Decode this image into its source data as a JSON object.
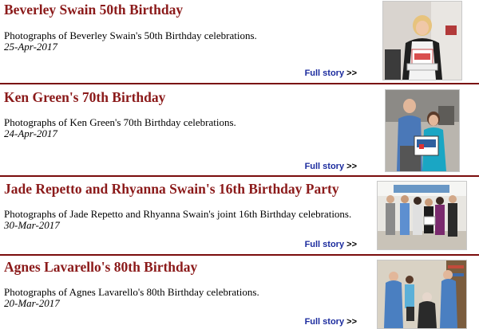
{
  "articles": [
    {
      "title": "Beverley Swain 50th Birthday",
      "description": "Photographs of Beverley Swain's 50th Birthday celebrations.",
      "date": "25-Apr-2017",
      "link_label": "Full story",
      "link_arrow": ">>"
    },
    {
      "title": "Ken Green's 70th Birthday",
      "description": "Photographs of Ken Green's 70th Birthday celebrations.",
      "date": "24-Apr-2017",
      "link_label": "Full story",
      "link_arrow": ">>"
    },
    {
      "title": "Jade Repetto and Rhyanna Swain's 16th Birthday Party",
      "description": "Photographs of Jade Repetto and Rhyanna Swain's joint 16th Birthday celebrations.",
      "date": "30-Mar-2017",
      "link_label": "Full story",
      "link_arrow": ">>"
    },
    {
      "title": "Agnes Lavarello's 80th Birthday",
      "description": "Photographs of Agnes Lavarello's 80th Birthday celebrations.",
      "date": "20-Mar-2017",
      "link_label": "Full story",
      "link_arrow": ">>"
    }
  ],
  "colors": {
    "title": "#8b1a1a",
    "divider": "#7a0c0c",
    "link": "#1b2b9e"
  }
}
